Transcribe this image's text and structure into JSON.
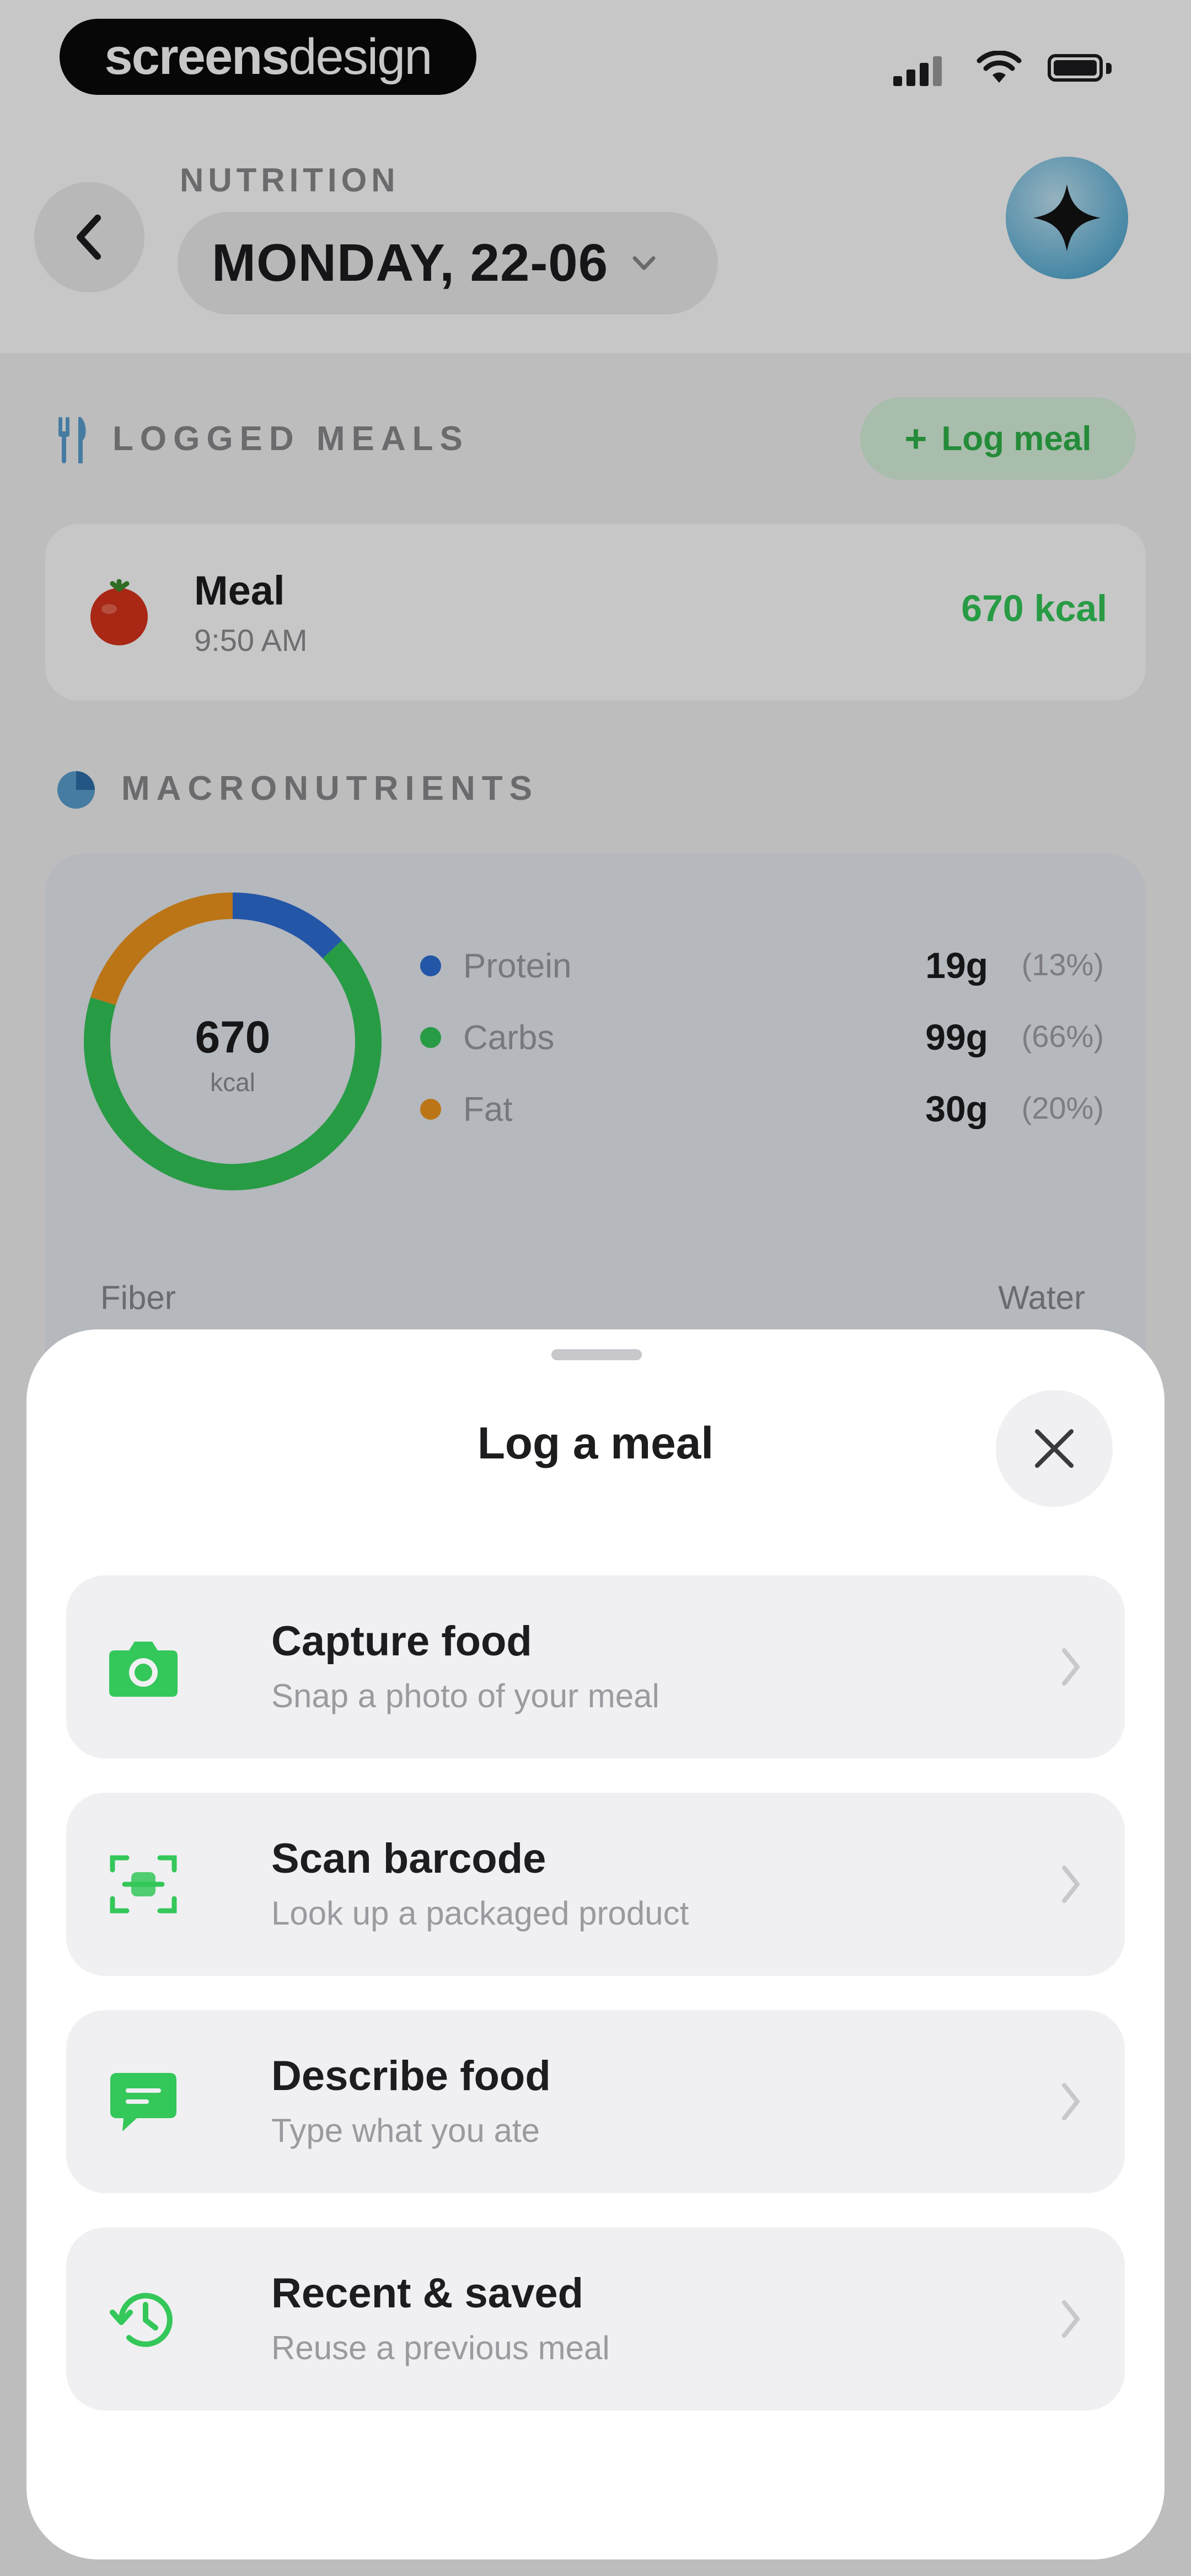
{
  "watermark": {
    "bold": "screens",
    "light": "design"
  },
  "header": {
    "overline": "NUTRITION",
    "date_label": "MONDAY, 22-06"
  },
  "logged_meals": {
    "section_title": "LOGGED MEALS",
    "log_button_label": "Log meal",
    "meals": [
      {
        "name": "Meal",
        "time": "9:50 AM",
        "kcal": "670 kcal"
      }
    ]
  },
  "macronutrients": {
    "section_title": "MACRONUTRIENTS",
    "total_kcal": "670",
    "total_unit": "kcal",
    "items": [
      {
        "name": "Protein",
        "amount": "19g",
        "percent": "(13%)",
        "color": "#2f6fd6",
        "share": 0.13
      },
      {
        "name": "Carbs",
        "amount": "99g",
        "percent": "(66%)",
        "color": "#34c759",
        "share": 0.66
      },
      {
        "name": "Fat",
        "amount": "30g",
        "percent": "(20%)",
        "color": "#f0961e",
        "share": 0.2
      }
    ],
    "fiber_label": "Fiber",
    "water_label": "Water"
  },
  "sheet": {
    "title": "Log a meal",
    "options": [
      {
        "title": "Capture food",
        "subtitle": "Snap a photo of your meal",
        "icon": "camera-icon"
      },
      {
        "title": "Scan barcode",
        "subtitle": "Look up a packaged product",
        "icon": "barcode-scan-icon"
      },
      {
        "title": "Describe food",
        "subtitle": "Type what you ate",
        "icon": "chat-bubble-icon"
      },
      {
        "title": "Recent & saved",
        "subtitle": "Reuse a previous meal",
        "icon": "history-icon"
      }
    ]
  },
  "colors": {
    "accent_green": "#34c759",
    "protein_blue": "#2f6fd6",
    "fat_orange": "#f0961e"
  }
}
